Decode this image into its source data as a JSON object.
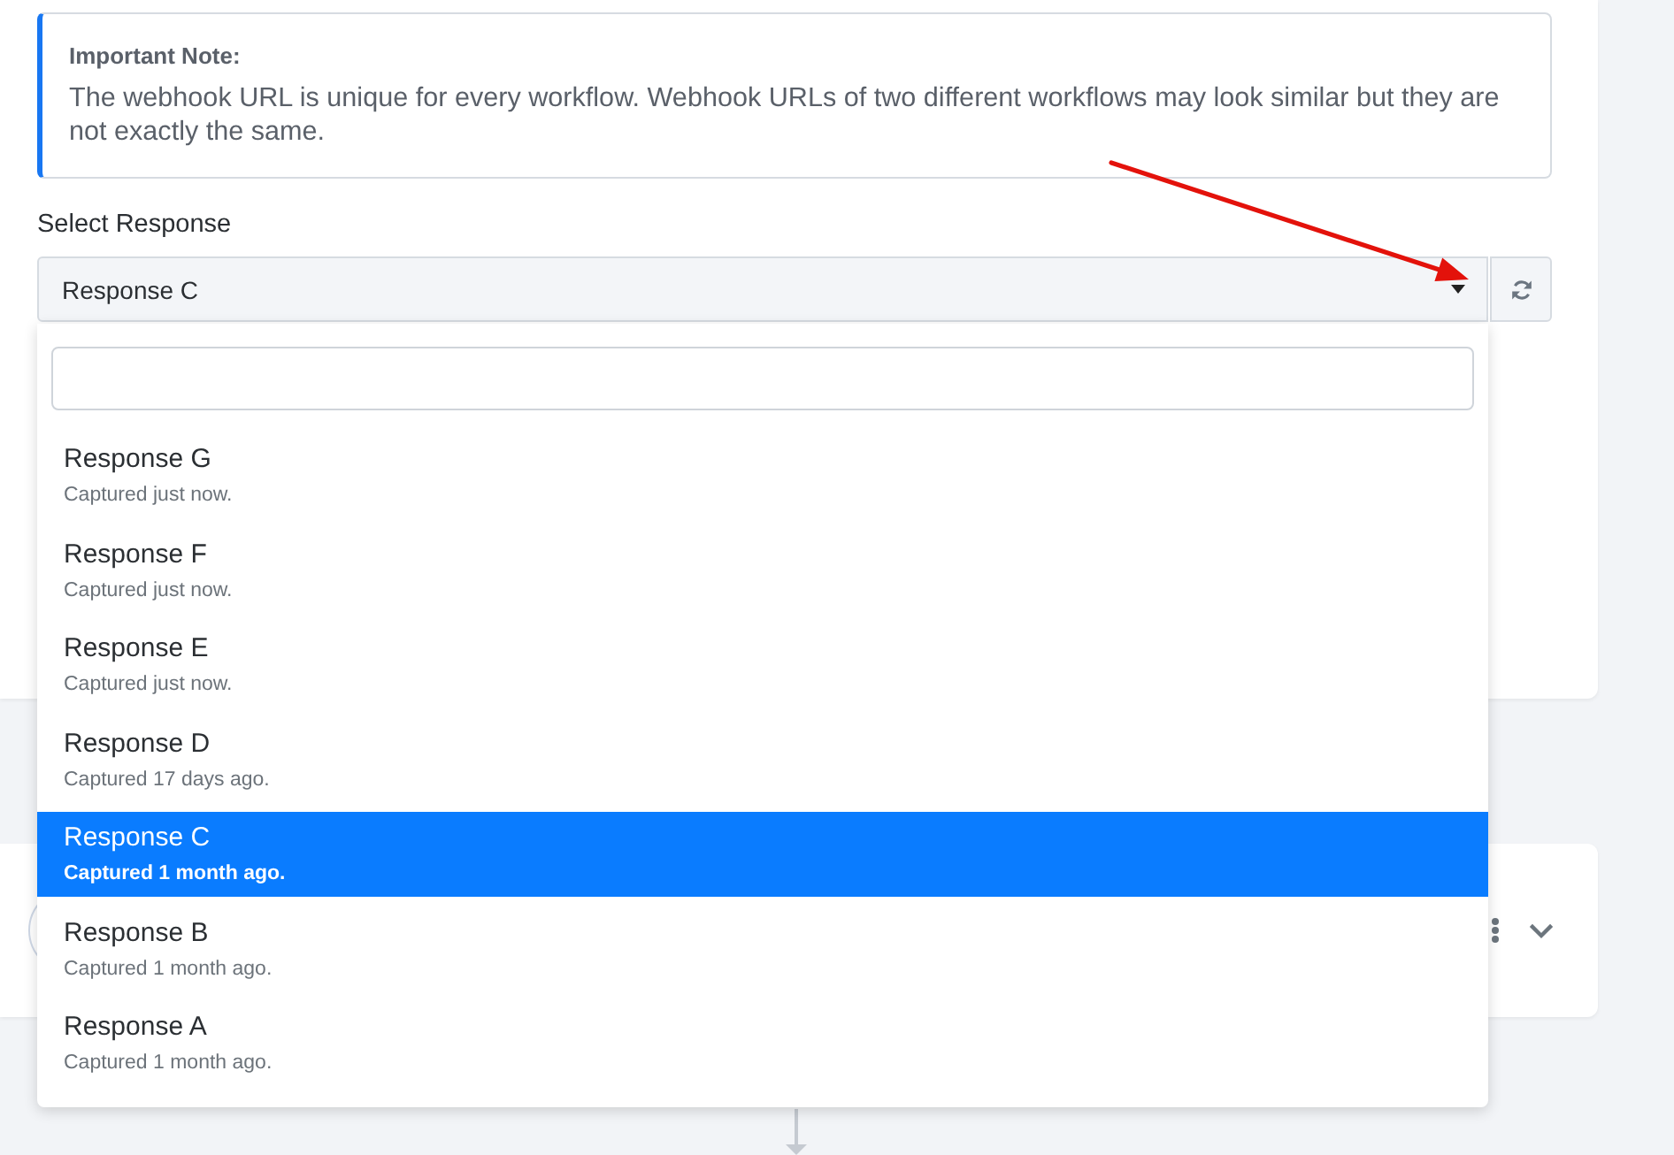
{
  "note": {
    "title": "Important Note:",
    "text": "The webhook URL is unique for every workflow. Webhook URLs of two different workflows may look similar but they are not exactly the same."
  },
  "select_response": {
    "label": "Select Response",
    "value": "Response C",
    "expanded": true,
    "options": [
      {
        "title": "Response G",
        "subtitle": "Captured just now.",
        "selected": false
      },
      {
        "title": "Response F",
        "subtitle": "Captured just now.",
        "selected": false
      },
      {
        "title": "Response E",
        "subtitle": "Captured just now.",
        "selected": false
      },
      {
        "title": "Response D",
        "subtitle": "Captured 17 days ago.",
        "selected": false
      },
      {
        "title": "Response C",
        "subtitle": "Captured 1 month ago.",
        "selected": true
      },
      {
        "title": "Response B",
        "subtitle": "Captured 1 month ago.",
        "selected": false
      },
      {
        "title": "Response A",
        "subtitle": "Captured 1 month ago.",
        "selected": false
      }
    ]
  }
}
